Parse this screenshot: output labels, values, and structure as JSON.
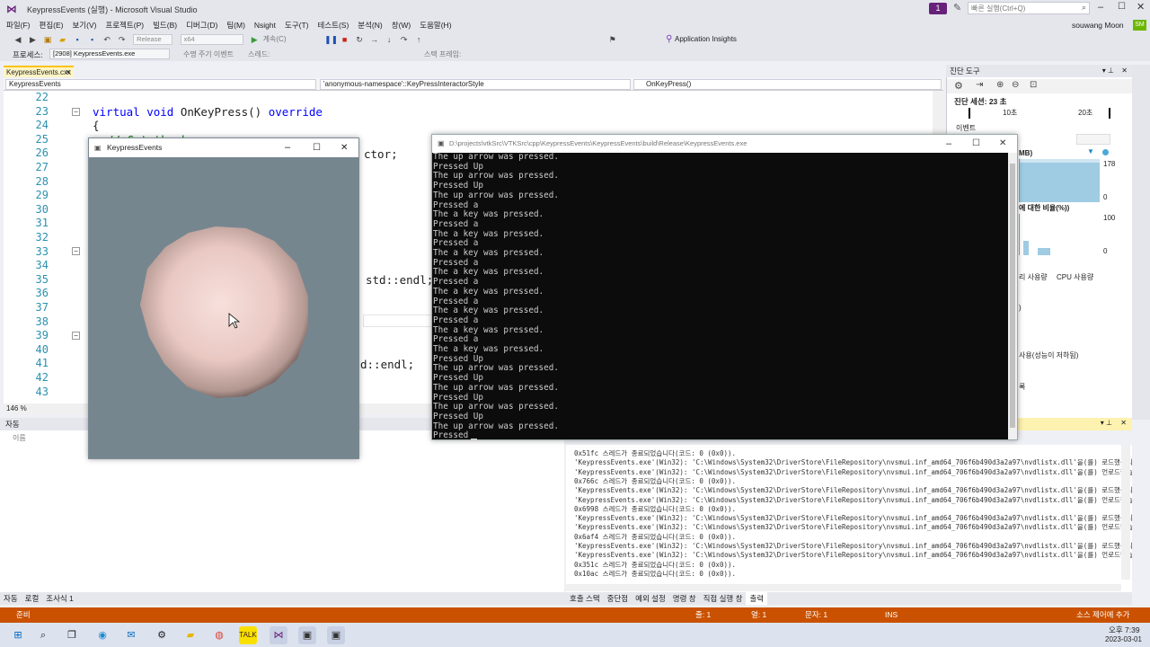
{
  "window": {
    "title": "KeypressEvents (실행) - Microsoft Visual Studio",
    "search_placeholder": "빠른 실행(Ctrl+Q)",
    "user_name": "souwang Moon",
    "user_initials": "SM",
    "notification_count": "1"
  },
  "menu": {
    "items": [
      "파일(F)",
      "편집(E)",
      "보기(V)",
      "프로젝트(P)",
      "빌드(B)",
      "디버그(D)",
      "팀(M)",
      "Nsight",
      "도구(T)",
      "테스트(S)",
      "분석(N)",
      "창(W)",
      "도움말(H)"
    ]
  },
  "toolbar": {
    "config": "Release",
    "platform": "x64",
    "continue_label": "계속(C)",
    "app_insights": "Application Insights"
  },
  "procbar": {
    "process_label": "프로세스:",
    "process_value": "[2908] KeypressEvents.exe",
    "lifecycle_label": "수명 주기 이벤트",
    "thread_label": "스레드:",
    "stack_label": "스택 프레임:"
  },
  "editor": {
    "tab": "KeypressEvents.cxx",
    "nav_project": "KeypressEvents",
    "nav_scope": "'anonymous-namespace'::KeyPressInteractorStyle",
    "nav_member": "OnKeyPress()",
    "zoom": "146 %",
    "line_numbers": [
      "22",
      "23",
      "24",
      "25",
      "26",
      "27",
      "28",
      "29",
      "30",
      "31",
      "32",
      "33",
      "34",
      "35",
      "36",
      "37",
      "38",
      "39",
      "40",
      "41",
      "42",
      "43"
    ],
    "code": {
      "virtual_kw": "virtual",
      "void_kw": "void",
      "fn_sig": "OnKeyPress()",
      "override_kw": "override",
      "brace": "{",
      "comment": "// Get the keypress",
      "frag_actor": "ctor;",
      "frag_endl": "std::endl;",
      "frag_endl2": "d::endl;"
    }
  },
  "autos": {
    "title": "자동",
    "col_name": "이름",
    "tabs": [
      "자동",
      "로컬",
      "조사식 1"
    ]
  },
  "diagnostics": {
    "title": "진단 도구",
    "session": "진단 세션: 23 초",
    "tick_10": "10초",
    "tick_20": "20초",
    "events": "이벤트",
    "mem_unit": "MB)",
    "mem_max": "178",
    "mem_min": "0",
    "cpu_label": "에 대한 비율(%))",
    "cpu_max": "100",
    "cpu_min": "0",
    "tab_mem": "리 사용량",
    "tab_cpu": "CPU 사용량",
    "frag_zero": ")",
    "frag_usage": "사용(성능이 저하됨)",
    "frag_k": "록"
  },
  "output": {
    "lines": [
      "0x51fc 스레드가 종료되었습니다(코드: 0 (0x0)).",
      "'KeypressEvents.exe'(Win32): 'C:\\Windows\\System32\\DriverStore\\FileRepository\\nvsmui.inf_amd64_706f6b490d3a2a97\\nvdlistx.dll'을(를) 로드했습니다",
      "'KeypressEvents.exe'(Win32): 'C:\\Windows\\System32\\DriverStore\\FileRepository\\nvsmui.inf_amd64_706f6b490d3a2a97\\nvdlistx.dll'을(를) 언로드했습니",
      "0x766c 스레드가 종료되었습니다(코드: 0 (0x0)).",
      "'KeypressEvents.exe'(Win32): 'C:\\Windows\\System32\\DriverStore\\FileRepository\\nvsmui.inf_amd64_706f6b490d3a2a97\\nvdlistx.dll'을(를) 로드했습니다",
      "'KeypressEvents.exe'(Win32): 'C:\\Windows\\System32\\DriverStore\\FileRepository\\nvsmui.inf_amd64_706f6b490d3a2a97\\nvdlistx.dll'을(를) 언로드했습니",
      "0x6998 스레드가 종료되었습니다(코드: 0 (0x0)).",
      "'KeypressEvents.exe'(Win32): 'C:\\Windows\\System32\\DriverStore\\FileRepository\\nvsmui.inf_amd64_706f6b490d3a2a97\\nvdlistx.dll'을(를) 로드했습니다",
      "'KeypressEvents.exe'(Win32): 'C:\\Windows\\System32\\DriverStore\\FileRepository\\nvsmui.inf_amd64_706f6b490d3a2a97\\nvdlistx.dll'을(를) 언로드했습니",
      "0x6af4 스레드가 종료되었습니다(코드: 0 (0x0)).",
      "'KeypressEvents.exe'(Win32): 'C:\\Windows\\System32\\DriverStore\\FileRepository\\nvsmui.inf_amd64_706f6b490d3a2a97\\nvdlistx.dll'을(를) 로드했습니다",
      "'KeypressEvents.exe'(Win32): 'C:\\Windows\\System32\\DriverStore\\FileRepository\\nvsmui.inf_amd64_706f6b490d3a2a97\\nvdlistx.dll'을(를) 언로드했습니",
      "0x351c 스레드가 종료되었습니다(코드: 0 (0x0)).",
      "0x10ac 스레드가 종료되었습니다(코드: 0 (0x0))."
    ],
    "tabs": [
      "호출 스택",
      "중단점",
      "예외 설정",
      "명령 창",
      "직접 실행 창",
      "출력"
    ]
  },
  "status": {
    "ready": "준비",
    "line": "줄: 1",
    "col": "열: 1",
    "char": "문자: 1",
    "ins": "INS",
    "source_control": "소스 제어에 추가"
  },
  "vtk": {
    "title": "KeypressEvents"
  },
  "console": {
    "title": "D:\\projects\\vtkSrc\\VTKSrc\\cpp\\KeypressEvents\\KeypressEvents\\build\\Release\\KeypressEvents.exe",
    "lines": [
      "The up arrow was pressed.",
      "Pressed Up",
      "The up arrow was pressed.",
      "Pressed Up",
      "The up arrow was pressed.",
      "Pressed a",
      "The a key was pressed.",
      "Pressed a",
      "The a key was pressed.",
      "Pressed a",
      "The a key was pressed.",
      "Pressed a",
      "The a key was pressed.",
      "Pressed a",
      "The a key was pressed.",
      "Pressed a",
      "The a key was pressed.",
      "Pressed a",
      "The a key was pressed.",
      "Pressed a",
      "The a key was pressed.",
      "Pressed Up",
      "The up arrow was pressed.",
      "Pressed Up",
      "The up arrow was pressed.",
      "Pressed Up",
      "The up arrow was pressed.",
      "Pressed Up",
      "The up arrow was pressed.",
      "Pressed"
    ]
  },
  "taskbar": {
    "time": "오후 7:39",
    "date": "2023-03-01"
  }
}
